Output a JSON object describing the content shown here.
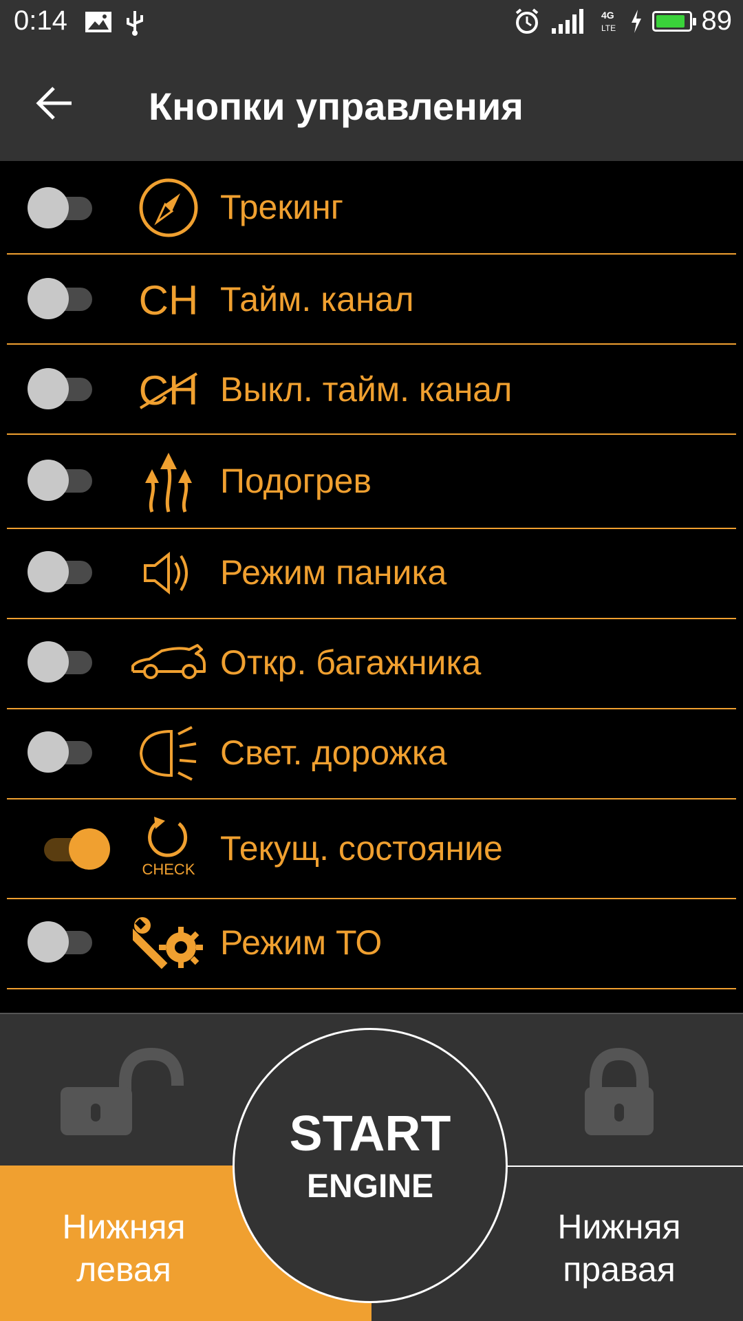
{
  "status_bar": {
    "time": "0:14",
    "battery_percent": "89",
    "battery_level": 0.89,
    "network": "4G LTE"
  },
  "appbar": {
    "title": "Кнопки управления",
    "back_icon": "arrow-left-icon"
  },
  "items": [
    {
      "label": "Трекинг",
      "icon": "compass-icon",
      "enabled": false
    },
    {
      "label": "Тайм. канал",
      "icon": "ch-text-icon",
      "icon_text": "CH",
      "enabled": false
    },
    {
      "label": "Выкл. тайм. канал",
      "icon": "ch-strikethrough-icon",
      "icon_text": "CH",
      "enabled": false
    },
    {
      "label": "Подогрев",
      "icon": "heat-arrows-icon",
      "enabled": false
    },
    {
      "label": "Режим паника",
      "icon": "speaker-icon",
      "enabled": false
    },
    {
      "label": "Откр. багажника",
      "icon": "car-trunk-icon",
      "enabled": false
    },
    {
      "label": "Свет. дорожка",
      "icon": "headlight-icon",
      "enabled": false
    },
    {
      "label": "Текущ. состояние",
      "icon": "check-refresh-icon",
      "icon_text": "CHECK",
      "enabled": true
    },
    {
      "label": "Режим ТО",
      "icon": "wrench-gear-icon",
      "enabled": false
    }
  ],
  "bottom": {
    "left_label": "Нижняя левая",
    "right_label": "Нижняя правая",
    "start_main": "START",
    "start_sub": "ENGINE",
    "left_icon": "unlocked-padlock-icon",
    "right_icon": "locked-padlock-icon"
  },
  "colors": {
    "accent": "#f0a030",
    "panel": "#333333",
    "background": "#000000",
    "toggle_off_thumb": "#c8c8c8"
  }
}
